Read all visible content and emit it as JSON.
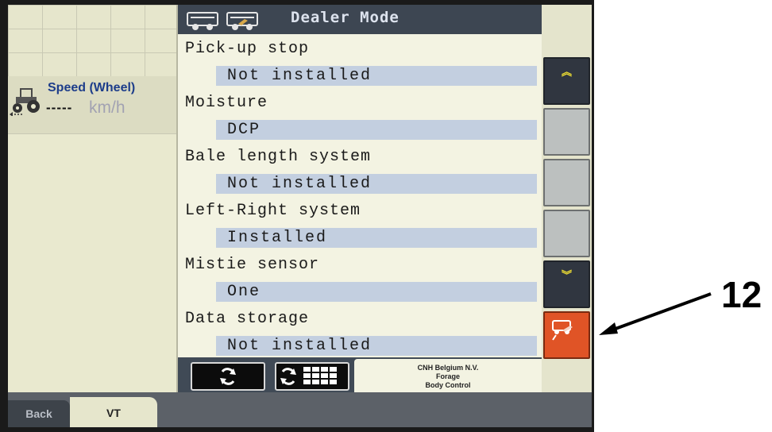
{
  "header": {
    "title": "Dealer Mode"
  },
  "speed_widget": {
    "label": "Speed (Wheel)",
    "value": "-----",
    "unit": "km/h"
  },
  "settings": [
    {
      "name": "Pick-up stop",
      "value": "Not installed"
    },
    {
      "name": "Moisture",
      "value": "DCP"
    },
    {
      "name": "Bale length system",
      "value": "Not installed"
    },
    {
      "name": "Left-Right system",
      "value": "Installed"
    },
    {
      "name": "Mistie sensor",
      "value": "One"
    },
    {
      "name": "Data storage",
      "value": "Not installed"
    }
  ],
  "footer": {
    "brand_line1": "CNH Belgium N.V.",
    "brand_line2": "Forage",
    "brand_line3": "Body Control"
  },
  "tabs": {
    "back": "Back",
    "vt": "VT"
  },
  "softkeys": [
    "page-up-chevron-icon",
    "blank",
    "blank",
    "blank",
    "page-down-chevron-icon",
    "dealer-mode-icon"
  ],
  "annotation": {
    "callout": "12"
  },
  "colors": {
    "header": "#3d4652",
    "value_highlight": "#c3cfe0",
    "dealer_key": "#e05426",
    "chevron": "#f0e032",
    "speed_label": "#1d3d8a"
  }
}
